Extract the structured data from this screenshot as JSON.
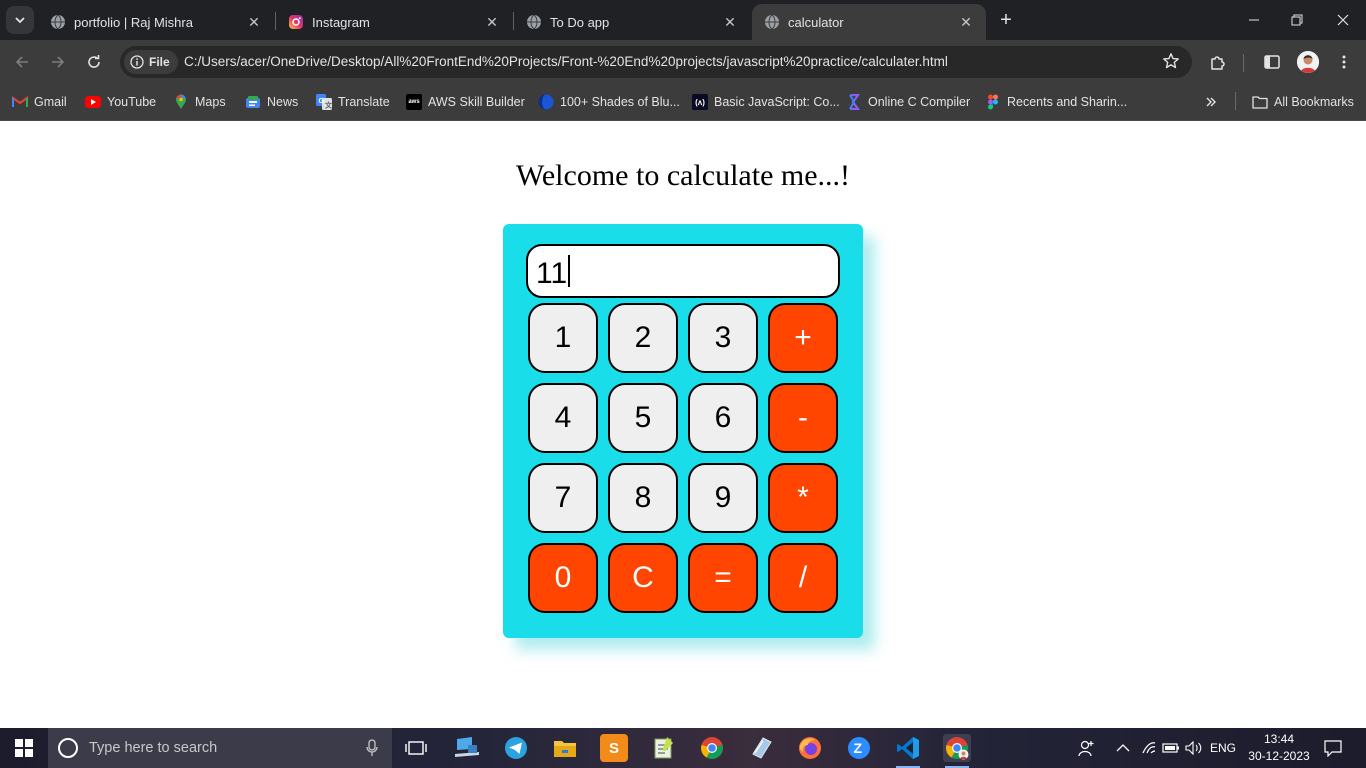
{
  "browser": {
    "tabs": [
      {
        "title": "portfolio | Raj Mishra",
        "icon": "globe-icon",
        "active": false
      },
      {
        "title": "Instagram",
        "icon": "instagram-icon",
        "active": false
      },
      {
        "title": "To Do app",
        "icon": "globe-icon",
        "active": false
      },
      {
        "title": "calculator",
        "icon": "globe-icon",
        "active": true
      }
    ],
    "address": {
      "chip_label": "File",
      "url": "C:/Users/acer/OneDrive/Desktop/All%20FrontEnd%20Projects/Front-%20End%20projects/javascript%20practice/calculater.html"
    },
    "bookmarks": [
      {
        "label": "Gmail",
        "icon": "gmail-icon"
      },
      {
        "label": "YouTube",
        "icon": "youtube-icon"
      },
      {
        "label": "Maps",
        "icon": "maps-icon"
      },
      {
        "label": "News",
        "icon": "news-icon"
      },
      {
        "label": "Translate",
        "icon": "translate-icon"
      },
      {
        "label": "AWS Skill Builder",
        "icon": "aws-icon"
      },
      {
        "label": "100+ Shades of Blu...",
        "icon": "globe-blue-icon"
      },
      {
        "label": "Basic JavaScript: Co...",
        "icon": "freecodecamp-icon"
      },
      {
        "label": "Online C Compiler",
        "icon": "compiler-icon"
      },
      {
        "label": "Recents and Sharin...",
        "icon": "figma-icon"
      }
    ],
    "all_bookmarks_label": "All Bookmarks"
  },
  "page": {
    "heading": "Welcome to calculate me...!",
    "display_value": "11",
    "keys": [
      {
        "label": "1",
        "kind": "number"
      },
      {
        "label": "2",
        "kind": "number"
      },
      {
        "label": "3",
        "kind": "number"
      },
      {
        "label": "+",
        "kind": "operator"
      },
      {
        "label": "4",
        "kind": "number"
      },
      {
        "label": "5",
        "kind": "number"
      },
      {
        "label": "6",
        "kind": "number"
      },
      {
        "label": "-",
        "kind": "operator"
      },
      {
        "label": "7",
        "kind": "number"
      },
      {
        "label": "8",
        "kind": "number"
      },
      {
        "label": "9",
        "kind": "number"
      },
      {
        "label": "*",
        "kind": "operator"
      },
      {
        "label": "0",
        "kind": "operator"
      },
      {
        "label": "C",
        "kind": "operator"
      },
      {
        "label": "=",
        "kind": "operator"
      },
      {
        "label": "/",
        "kind": "operator"
      }
    ],
    "colors": {
      "calculator_bg": "#19dde8",
      "operator_key": "#ff4500",
      "number_key": "#efefef"
    }
  },
  "taskbar": {
    "search_placeholder": "Type here to search",
    "language": "ENG",
    "time": "13:44",
    "date": "30-12-2023"
  }
}
